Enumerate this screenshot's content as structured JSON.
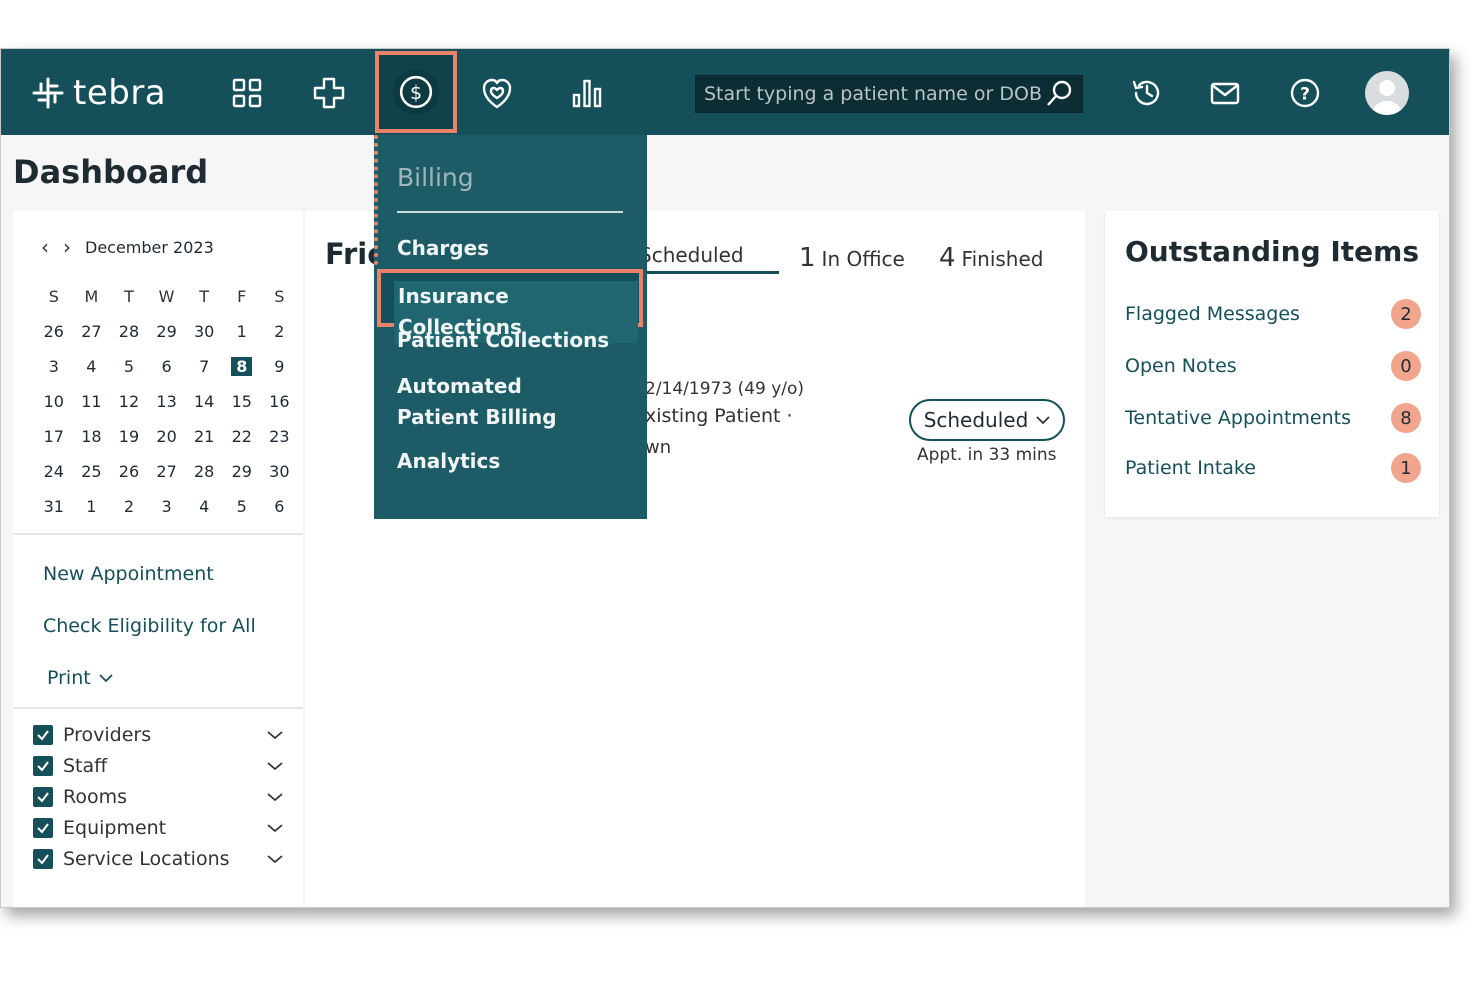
{
  "topbar": {
    "logo_text": "tebra",
    "search_placeholder": "Start typing a patient name or DOB",
    "icons": [
      "grid-icon",
      "medical-cross-icon",
      "dollar-circle-icon",
      "heart-shield-icon",
      "bar-chart-icon",
      "history-icon",
      "mail-icon",
      "help-icon"
    ]
  },
  "page": {
    "title": "Dashboard"
  },
  "calendar": {
    "month_label": "December 2023",
    "weekdays": [
      "S",
      "M",
      "T",
      "W",
      "T",
      "F",
      "S"
    ],
    "days": [
      "26",
      "27",
      "28",
      "29",
      "30",
      "1",
      "2",
      "3",
      "4",
      "5",
      "6",
      "7",
      "8",
      "9",
      "10",
      "11",
      "12",
      "13",
      "14",
      "15",
      "16",
      "17",
      "18",
      "19",
      "20",
      "21",
      "22",
      "23",
      "24",
      "25",
      "26",
      "27",
      "28",
      "29",
      "30",
      "31",
      "1",
      "2",
      "3",
      "4",
      "5",
      "6"
    ],
    "today": "8"
  },
  "actions": {
    "new_appointment": "New Appointment",
    "check_eligibility": "Check Eligibility for All",
    "print": "Print"
  },
  "filters": [
    "Providers",
    "Staff",
    "Rooms",
    "Equipment",
    "Service Locations"
  ],
  "center": {
    "day_title_partial": "Fric",
    "tabs": [
      {
        "count": "",
        "label": "Scheduled"
      },
      {
        "count": "1",
        "label": "In Office"
      },
      {
        "count": "4",
        "label": "Finished"
      }
    ],
    "patient_dob_partial": "2/14/1973 (49 y/o)",
    "patient_type_partial": "xisting Patient ·",
    "patient_extra_partial": "wn",
    "status": "Scheduled",
    "appt_time": "Appt. in 33 mins"
  },
  "outstanding": {
    "title": "Outstanding Items",
    "items": [
      {
        "label": "Flagged Messages",
        "count": "2"
      },
      {
        "label": "Open Notes",
        "count": "0"
      },
      {
        "label": "Tentative Appointments",
        "count": "8"
      },
      {
        "label": "Patient Intake",
        "count": "1"
      }
    ]
  },
  "billing_menu": {
    "heading": "Billing",
    "items": [
      "Charges",
      "Insurance Collections",
      "Patient Collections",
      "Automated Patient Billing",
      "Analytics"
    ],
    "highlighted": "Insurance Collections"
  },
  "colors": {
    "brand": "#15505a",
    "highlight": "#e8836a",
    "badge": "#f2a58d"
  }
}
